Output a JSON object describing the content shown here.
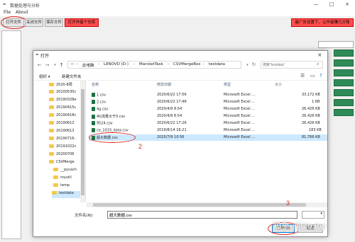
{
  "window": {
    "title": "数据处理与分析",
    "controls": [
      "—",
      "□",
      "×"
    ]
  },
  "menu": [
    "File",
    "About"
  ],
  "toolbar": {
    "open_file": "打开文件",
    "close_file": "关闭文件",
    "save_file": "保存文件",
    "open_multiple": "打开作者个仓库",
    "update_banner": "最广告设置下，让作者赚几分钱"
  },
  "annotations": {
    "step1": "1",
    "step2": "2",
    "step3": "3"
  },
  "dialog": {
    "title": "打开",
    "nav": {
      "back": "←",
      "forward": "→",
      "up": "↑"
    },
    "address": [
      "此电脑",
      "LENOVO (D:)",
      "MarcketTask",
      "CSVMergeBox",
      "testdata"
    ],
    "search_placeholder": "搜索\"testdata\"",
    "organize": "组织 ▾",
    "new_folder": "新建文件夹",
    "folders": [
      "2020-8周",
      "20100530c",
      "20190328e",
      "20190415c",
      "20190418c",
      "20190612",
      "20190613",
      "20190716-",
      "20191022c",
      "20200706",
      "CSVMerge",
      "__pycach",
      "myutil",
      "temp",
      "testdata"
    ],
    "columns": {
      "name": "名称",
      "modified": "修改日期",
      "type": "类型",
      "size": "大小"
    },
    "files": [
      {
        "name": "1.csv",
        "modified": "2020/6/22 17:56",
        "type": "Microsoft Excel ...",
        "size": "33,172 KB"
      },
      {
        "name": "2.csv",
        "modified": "2020/6/22 17:46",
        "type": "Microsoft Excel ...",
        "size": "1 KB"
      },
      {
        "name": "4g.csv",
        "modified": "2020/4/9 8:54",
        "type": "Microsoft Excel ...",
        "size": "26,426 KB"
      },
      {
        "name": "4G流量大于0.csv",
        "modified": "2020/4/9 8:54",
        "type": "Microsoft Excel ...",
        "size": "26,426 KB"
      },
      {
        "name": "9524.csv",
        "modified": "2020/6/22 17:26",
        "type": "Microsoft Excel ...",
        "size": "26,426 KB"
      },
      {
        "name": "ce_1033_data.csv",
        "modified": "2019/8/14 16:21",
        "type": "Microsoft Excel ...",
        "size": "183 KB"
      },
      {
        "name": "超大数据.csv",
        "modified": "2020/7/9 10:56",
        "type": "Microsoft Excel ...",
        "size": "81,766 KB"
      }
    ],
    "filename_label": "文件名(N):",
    "filename_value": "超大数据.csv",
    "open_button": "打开(O)",
    "cancel_button": "取消"
  },
  "watermark": "知乎 @tito.top",
  "colors": {
    "annotation_red": "#e0261d",
    "selection": "#cce8ff",
    "accent_green": "#2e8b57"
  }
}
